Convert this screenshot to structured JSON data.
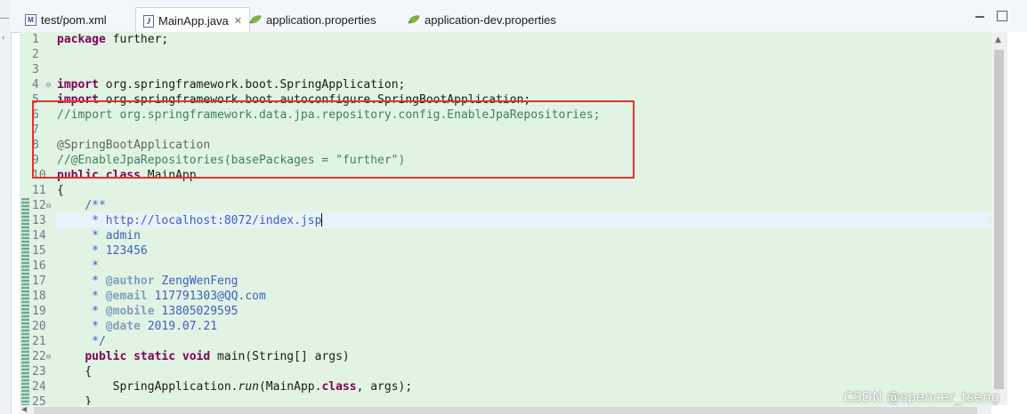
{
  "tabs": [
    {
      "label": "test/pom.xml",
      "icon": "maven-pom-file-icon",
      "active": false
    },
    {
      "label": "MainApp.java",
      "icon": "java-file-icon",
      "active": true,
      "close": "✕"
    },
    {
      "label": "application.properties",
      "icon": "properties-file-icon",
      "active": false
    },
    {
      "label": "application-dev.properties",
      "icon": "properties-file-icon",
      "active": false
    }
  ],
  "editor": {
    "lines": [
      {
        "n": "1",
        "fold": "",
        "html": "<span class=\"kw\">package</span> further;"
      },
      {
        "n": "2",
        "fold": "",
        "html": ""
      },
      {
        "n": "3",
        "fold": "",
        "html": ""
      },
      {
        "n": "4",
        "fold": "⊖",
        "html": "<span class=\"kw\">import</span> org.springframework.boot.SpringApplication;"
      },
      {
        "n": "5",
        "fold": "",
        "html": "<span class=\"kw\">import</span> org.springframework.boot.autoconfigure.SpringBootApplication;"
      },
      {
        "n": "6",
        "fold": "",
        "html": "<span class=\"cmt\">//import org.springframework.data.jpa.repository.config.EnableJpaRepositories;</span>"
      },
      {
        "n": "7",
        "fold": "",
        "html": ""
      },
      {
        "n": "8",
        "fold": "",
        "html": "<span class=\"ann\">@SpringBootApplication</span>"
      },
      {
        "n": "9",
        "fold": "",
        "html": "<span class=\"cmt\">//@EnableJpaRepositories(basePackages = \"further\")</span>"
      },
      {
        "n": "10",
        "fold": "",
        "html": "<span class=\"kw\">public</span> <span class=\"kw\">class</span> MainApp"
      },
      {
        "n": "11",
        "fold": "",
        "html": "{"
      },
      {
        "n": "12",
        "fold": "⊖",
        "html": "    <span class=\"jd\">/**</span>"
      },
      {
        "n": "13",
        "fold": "",
        "html": "<span class=\"jd\">     * http://localhost:8072/index.jsp</span>",
        "current": true
      },
      {
        "n": "14",
        "fold": "",
        "html": "<span class=\"jd\">     * admin</span>"
      },
      {
        "n": "15",
        "fold": "",
        "html": "<span class=\"jd\">     * 123456</span>"
      },
      {
        "n": "16",
        "fold": "",
        "html": "<span class=\"jd\">     *</span>"
      },
      {
        "n": "17",
        "fold": "",
        "html": "<span class=\"jd\">     * </span><span class=\"tag\">@author</span><span class=\"jd\"> ZengWenFeng</span>"
      },
      {
        "n": "18",
        "fold": "",
        "html": "<span class=\"jd\">     * </span><span class=\"tag\">@email</span><span class=\"jd\"> 117791303@QQ.com</span>"
      },
      {
        "n": "19",
        "fold": "",
        "html": "<span class=\"jd\">     * </span><span class=\"tag\">@mobile</span><span class=\"jd\"> 13805029595</span>"
      },
      {
        "n": "20",
        "fold": "",
        "html": "<span class=\"jd\">     * </span><span class=\"tag\">@date</span><span class=\"jd\"> 2019.07.21</span>"
      },
      {
        "n": "21",
        "fold": "",
        "html": "<span class=\"jd\">     */</span>"
      },
      {
        "n": "22",
        "fold": "⊖",
        "html": "    <span class=\"kw\">public</span> <span class=\"kw\">static</span> <span class=\"kw\">void</span> main(String[] args)"
      },
      {
        "n": "23",
        "fold": "",
        "html": "    {"
      },
      {
        "n": "24",
        "fold": "",
        "html": "        SpringApplication.<span class=\"it\">run</span>(MainApp.<span class=\"kw\">class</span>, args);"
      },
      {
        "n": "25",
        "fold": "",
        "html": "    }"
      }
    ]
  },
  "watermark": "CSDN @spencer_tseng",
  "colors": {
    "editor_bg": "#e1f3e3",
    "keyword": "#7f0055",
    "comment": "#3f7f5f",
    "javadoc": "#3f5fbf",
    "highlight_box": "#e0332f"
  }
}
